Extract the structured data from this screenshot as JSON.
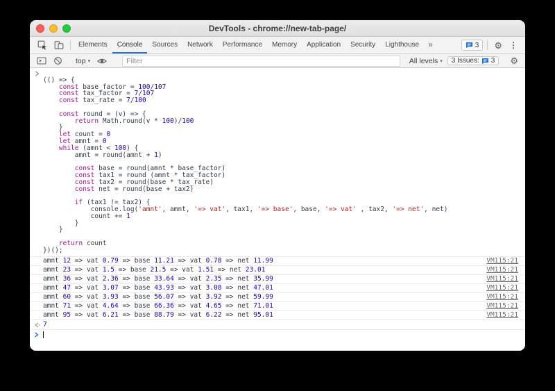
{
  "colors": {
    "accent": "#1a73e8",
    "keyword": "#aa0d91",
    "number": "#1c00cf",
    "string": "#c41a16",
    "code-text": "#303942",
    "link": "#6e6e6e"
  },
  "window": {
    "title": "DevTools - chrome://new-tab-page/"
  },
  "tabbar": {
    "tabs": [
      {
        "label": "Elements",
        "active": false
      },
      {
        "label": "Console",
        "active": true
      },
      {
        "label": "Sources",
        "active": false
      },
      {
        "label": "Network",
        "active": false
      },
      {
        "label": "Performance",
        "active": false
      },
      {
        "label": "Memory",
        "active": false
      },
      {
        "label": "Application",
        "active": false
      },
      {
        "label": "Security",
        "active": false
      },
      {
        "label": "Lighthouse",
        "active": false
      }
    ],
    "overflow_label": "»",
    "issues_count": "3"
  },
  "toolbar": {
    "context_selector": "top",
    "filter_placeholder": "Filter",
    "levels_label": "All levels",
    "issues_label": "3 Issues:",
    "issues_count": "3"
  },
  "icons": {
    "dropdown_arrow": "▾",
    "gear": "⚙",
    "kebab": "⋮"
  },
  "console": {
    "code_lines": [
      [],
      [
        [
          "pl",
          "(() => {"
        ]
      ],
      [
        [
          "pl",
          "    "
        ],
        [
          "kw",
          "const"
        ],
        [
          "pl",
          " base_factor = "
        ],
        [
          "num",
          "100"
        ],
        [
          "pl",
          "/"
        ],
        [
          "num",
          "107"
        ]
      ],
      [
        [
          "pl",
          "    "
        ],
        [
          "kw",
          "const"
        ],
        [
          "pl",
          " tax_factor = "
        ],
        [
          "num",
          "7"
        ],
        [
          "pl",
          "/"
        ],
        [
          "num",
          "107"
        ]
      ],
      [
        [
          "pl",
          "    "
        ],
        [
          "kw",
          "const"
        ],
        [
          "pl",
          " tax_rate = "
        ],
        [
          "num",
          "7"
        ],
        [
          "pl",
          "/"
        ],
        [
          "num",
          "100"
        ]
      ],
      [],
      [
        [
          "pl",
          "    "
        ],
        [
          "kw",
          "const"
        ],
        [
          "pl",
          " round = (v) => {"
        ]
      ],
      [
        [
          "pl",
          "        "
        ],
        [
          "kw",
          "return"
        ],
        [
          "pl",
          " Math.round(v * "
        ],
        [
          "num",
          "100"
        ],
        [
          "pl",
          ")/"
        ],
        [
          "num",
          "100"
        ]
      ],
      [
        [
          "pl",
          "    }"
        ]
      ],
      [
        [
          "pl",
          "    "
        ],
        [
          "kw",
          "let"
        ],
        [
          "pl",
          " count = "
        ],
        [
          "num",
          "0"
        ]
      ],
      [
        [
          "pl",
          "    "
        ],
        [
          "kw",
          "let"
        ],
        [
          "pl",
          " amnt = "
        ],
        [
          "num",
          "0"
        ]
      ],
      [
        [
          "pl",
          "    "
        ],
        [
          "kw",
          "while"
        ],
        [
          "pl",
          " (amnt < "
        ],
        [
          "num",
          "100"
        ],
        [
          "pl",
          ") {"
        ]
      ],
      [
        [
          "pl",
          "        amnt = round(amnt + "
        ],
        [
          "num",
          "1"
        ],
        [
          "pl",
          ")"
        ]
      ],
      [],
      [
        [
          "pl",
          "        "
        ],
        [
          "kw",
          "const"
        ],
        [
          "pl",
          " base = round(amnt * base_factor)"
        ]
      ],
      [
        [
          "pl",
          "        "
        ],
        [
          "kw",
          "const"
        ],
        [
          "pl",
          " tax1 = round (amnt * tax_factor)"
        ]
      ],
      [
        [
          "pl",
          "        "
        ],
        [
          "kw",
          "const"
        ],
        [
          "pl",
          " tax2 = round(base * tax_rate)"
        ]
      ],
      [
        [
          "pl",
          "        "
        ],
        [
          "kw",
          "const"
        ],
        [
          "pl",
          " net = round(base + tax2)"
        ]
      ],
      [],
      [
        [
          "pl",
          "        "
        ],
        [
          "kw",
          "if"
        ],
        [
          "pl",
          " (tax1 != tax2) {"
        ]
      ],
      [
        [
          "pl",
          "            console.log("
        ],
        [
          "str",
          "'amnt'"
        ],
        [
          "pl",
          ", amnt, "
        ],
        [
          "str",
          "'=> vat'"
        ],
        [
          "pl",
          ", tax1, "
        ],
        [
          "str",
          "'=> base'"
        ],
        [
          "pl",
          ", base, "
        ],
        [
          "str",
          "'=> vat'"
        ],
        [
          "pl",
          " , tax2, "
        ],
        [
          "str",
          "'=> net'"
        ],
        [
          "pl",
          ", net)"
        ]
      ],
      [
        [
          "pl",
          "            count += "
        ],
        [
          "num",
          "1"
        ]
      ],
      [
        [
          "pl",
          "        }"
        ]
      ],
      [
        [
          "pl",
          "    }"
        ]
      ],
      [],
      [
        [
          "pl",
          "    "
        ],
        [
          "kw",
          "return"
        ],
        [
          "pl",
          " count"
        ]
      ],
      [
        [
          "pl",
          "})();"
        ]
      ]
    ],
    "log_rows": [
      {
        "parts": [
          [
            "pl",
            "amnt "
          ],
          [
            "num",
            "12"
          ],
          [
            "pl",
            " => vat "
          ],
          [
            "num",
            "0.79"
          ],
          [
            "pl",
            " => base "
          ],
          [
            "num",
            "11.21"
          ],
          [
            "pl",
            " => vat "
          ],
          [
            "num",
            "0.78"
          ],
          [
            "pl",
            " => net "
          ],
          [
            "num",
            "11.99"
          ]
        ],
        "source": "VM115:21"
      },
      {
        "parts": [
          [
            "pl",
            "amnt "
          ],
          [
            "num",
            "23"
          ],
          [
            "pl",
            " => vat "
          ],
          [
            "num",
            "1.5"
          ],
          [
            "pl",
            " => base "
          ],
          [
            "num",
            "21.5"
          ],
          [
            "pl",
            " => vat "
          ],
          [
            "num",
            "1.51"
          ],
          [
            "pl",
            " => net "
          ],
          [
            "num",
            "23.01"
          ]
        ],
        "source": "VM115:21"
      },
      {
        "parts": [
          [
            "pl",
            "amnt "
          ],
          [
            "num",
            "36"
          ],
          [
            "pl",
            " => vat "
          ],
          [
            "num",
            "2.36"
          ],
          [
            "pl",
            " => base "
          ],
          [
            "num",
            "33.64"
          ],
          [
            "pl",
            " => vat "
          ],
          [
            "num",
            "2.35"
          ],
          [
            "pl",
            " => net "
          ],
          [
            "num",
            "35.99"
          ]
        ],
        "source": "VM115:21"
      },
      {
        "parts": [
          [
            "pl",
            "amnt "
          ],
          [
            "num",
            "47"
          ],
          [
            "pl",
            " => vat "
          ],
          [
            "num",
            "3.07"
          ],
          [
            "pl",
            " => base "
          ],
          [
            "num",
            "43.93"
          ],
          [
            "pl",
            " => vat "
          ],
          [
            "num",
            "3.08"
          ],
          [
            "pl",
            " => net "
          ],
          [
            "num",
            "47.01"
          ]
        ],
        "source": "VM115:21"
      },
      {
        "parts": [
          [
            "pl",
            "amnt "
          ],
          [
            "num",
            "60"
          ],
          [
            "pl",
            " => vat "
          ],
          [
            "num",
            "3.93"
          ],
          [
            "pl",
            " => base "
          ],
          [
            "num",
            "56.07"
          ],
          [
            "pl",
            " => vat "
          ],
          [
            "num",
            "3.92"
          ],
          [
            "pl",
            " => net "
          ],
          [
            "num",
            "59.99"
          ]
        ],
        "source": "VM115:21"
      },
      {
        "parts": [
          [
            "pl",
            "amnt "
          ],
          [
            "num",
            "71"
          ],
          [
            "pl",
            " => vat "
          ],
          [
            "num",
            "4.64"
          ],
          [
            "pl",
            " => base "
          ],
          [
            "num",
            "66.36"
          ],
          [
            "pl",
            " => vat "
          ],
          [
            "num",
            "4.65"
          ],
          [
            "pl",
            " => net "
          ],
          [
            "num",
            "71.01"
          ]
        ],
        "source": "VM115:21"
      },
      {
        "parts": [
          [
            "pl",
            "amnt "
          ],
          [
            "num",
            "95"
          ],
          [
            "pl",
            " => vat "
          ],
          [
            "num",
            "6.21"
          ],
          [
            "pl",
            " => base "
          ],
          [
            "num",
            "88.79"
          ],
          [
            "pl",
            " => vat "
          ],
          [
            "num",
            "6.22"
          ],
          [
            "pl",
            " => net "
          ],
          [
            "num",
            "95.01"
          ]
        ],
        "source": "VM115:21"
      }
    ],
    "result_value": "7"
  }
}
